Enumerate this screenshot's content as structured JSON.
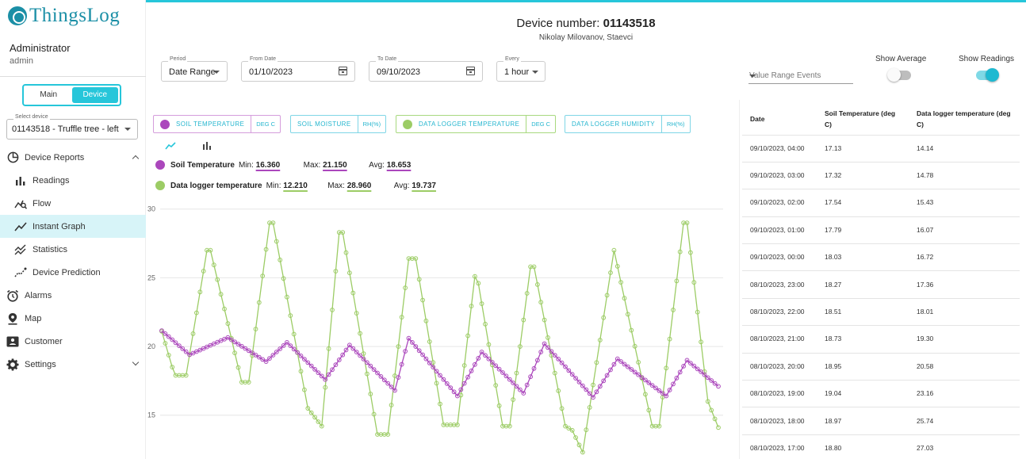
{
  "brand": {
    "logo_text": "ThingsLog"
  },
  "user": {
    "name": "Administrator",
    "role": "admin"
  },
  "mode_toggle": {
    "main": "Main",
    "device": "Device"
  },
  "device_select": {
    "label": "Select device",
    "value": "01143518 - Truffle tree - left"
  },
  "nav": {
    "device_reports": "Device Reports",
    "readings": "Readings",
    "flow": "Flow",
    "instant_graph": "Instant Graph",
    "statistics": "Statistics",
    "device_prediction": "Device Prediction",
    "alarms": "Alarms",
    "map": "Map",
    "customer": "Customer",
    "settings": "Settings"
  },
  "header": {
    "device_prefix": "Device number: ",
    "device_number": "01143518",
    "subtitle": "Nikolay Milovanov, Staevci"
  },
  "filters": {
    "period_label": "Period",
    "period_value": "Date Range",
    "from_label": "From Date",
    "from_value": "01/10/2023",
    "to_label": "To Date",
    "to_value": "09/10/2023",
    "every_label": "Every",
    "every_value": "1 hour",
    "value_range_events": "Value Range Events",
    "show_average": "Show Average",
    "show_readings": "Show Readings"
  },
  "toggles": {
    "show_average": false,
    "show_readings": true
  },
  "colors": {
    "accent": "#26c6da",
    "soil_temperature": "#ab47bc",
    "logger_temperature": "#9ccc65",
    "brand": "#1b8fa6"
  },
  "sensors": [
    {
      "name": "SOIL TEMPERATURE",
      "unit": "DEG C",
      "active": true
    },
    {
      "name": "SOIL MOISTURE",
      "unit": "RH(%)",
      "active": false
    },
    {
      "name": "DATA LOGGER TEMPERATURE",
      "unit": "DEG C",
      "active": true
    },
    {
      "name": "DATA LOGGER HUMIDITY",
      "unit": "RH(%)",
      "active": false
    }
  ],
  "stats": [
    {
      "name": "Soil Temperature",
      "min_label": "Min:",
      "min": "16.360",
      "max_label": "Max:",
      "max": "21.150",
      "avg_label": "Avg:",
      "avg": "18.653"
    },
    {
      "name": "Data logger temperature",
      "min_label": "Min:",
      "min": "12.210",
      "max_label": "Max:",
      "max": "28.960",
      "avg_label": "Avg:",
      "avg": "19.737"
    }
  ],
  "table": {
    "headers": [
      "Date",
      "Soil Temperature (deg C)",
      "Data logger temperature (deg C)"
    ],
    "rows": [
      [
        "09/10/2023, 04:00",
        "17.13",
        "14.14"
      ],
      [
        "09/10/2023, 03:00",
        "17.32",
        "14.78"
      ],
      [
        "09/10/2023, 02:00",
        "17.54",
        "15.43"
      ],
      [
        "09/10/2023, 01:00",
        "17.79",
        "16.07"
      ],
      [
        "09/10/2023, 00:00",
        "18.03",
        "16.72"
      ],
      [
        "08/10/2023, 23:00",
        "18.27",
        "17.36"
      ],
      [
        "08/10/2023, 22:00",
        "18.51",
        "18.01"
      ],
      [
        "08/10/2023, 21:00",
        "18.73",
        "19.30"
      ],
      [
        "08/10/2023, 20:00",
        "18.95",
        "20.58"
      ],
      [
        "08/10/2023, 19:00",
        "19.04",
        "23.16"
      ],
      [
        "08/10/2023, 18:00",
        "18.97",
        "25.74"
      ],
      [
        "08/10/2023, 17:00",
        "18.80",
        "27.03"
      ]
    ]
  },
  "chart_data": {
    "type": "line",
    "ylim": [
      11.5,
      31
    ],
    "yticks": [
      15,
      20,
      25,
      30
    ],
    "grid": true,
    "series": [
      {
        "name": "Soil Temperature",
        "color": "#ab47bc",
        "anchors": [
          [
            0,
            21.15
          ],
          [
            8,
            19.4
          ],
          [
            19,
            20.65
          ],
          [
            30,
            18.9
          ],
          [
            36,
            20.3
          ],
          [
            47,
            17.6
          ],
          [
            54,
            20.1
          ],
          [
            67,
            16.8
          ],
          [
            71,
            20.6
          ],
          [
            85,
            16.4
          ],
          [
            92,
            19.6
          ],
          [
            104,
            16.6
          ],
          [
            110,
            20.2
          ],
          [
            124,
            16.3
          ],
          [
            131,
            19.1
          ],
          [
            145,
            16.4
          ],
          [
            151,
            19.0
          ],
          [
            160,
            17.1
          ]
        ]
      },
      {
        "name": "Data logger temperature",
        "color": "#9ccc65",
        "anchors": [
          [
            0,
            21.1
          ],
          [
            3,
            18.5
          ],
          [
            4,
            17.9
          ],
          [
            7,
            17.9
          ],
          [
            13,
            27.0
          ],
          [
            14,
            27.0
          ],
          [
            23,
            17.4
          ],
          [
            25,
            17.4
          ],
          [
            31,
            29.0
          ],
          [
            32,
            29.0
          ],
          [
            42,
            15.5
          ],
          [
            46,
            14.2
          ],
          [
            51,
            28.3
          ],
          [
            52,
            28.3
          ],
          [
            62,
            13.6
          ],
          [
            65,
            13.6
          ],
          [
            71,
            26.4
          ],
          [
            73,
            26.4
          ],
          [
            81,
            14.3
          ],
          [
            85,
            14.3
          ],
          [
            90,
            25.1
          ],
          [
            91,
            24.6
          ],
          [
            98,
            14.2
          ],
          [
            100,
            14.2
          ],
          [
            106,
            25.8
          ],
          [
            107,
            25.8
          ],
          [
            116,
            14.2
          ],
          [
            118,
            13.9
          ],
          [
            121,
            12.3
          ],
          [
            130,
            27.0
          ],
          [
            141,
            14.2
          ],
          [
            143,
            14.2
          ],
          [
            150,
            29.0
          ],
          [
            151,
            29.0
          ],
          [
            157,
            16.0
          ],
          [
            160,
            14.1
          ]
        ]
      }
    ],
    "points_per_series": 161
  }
}
